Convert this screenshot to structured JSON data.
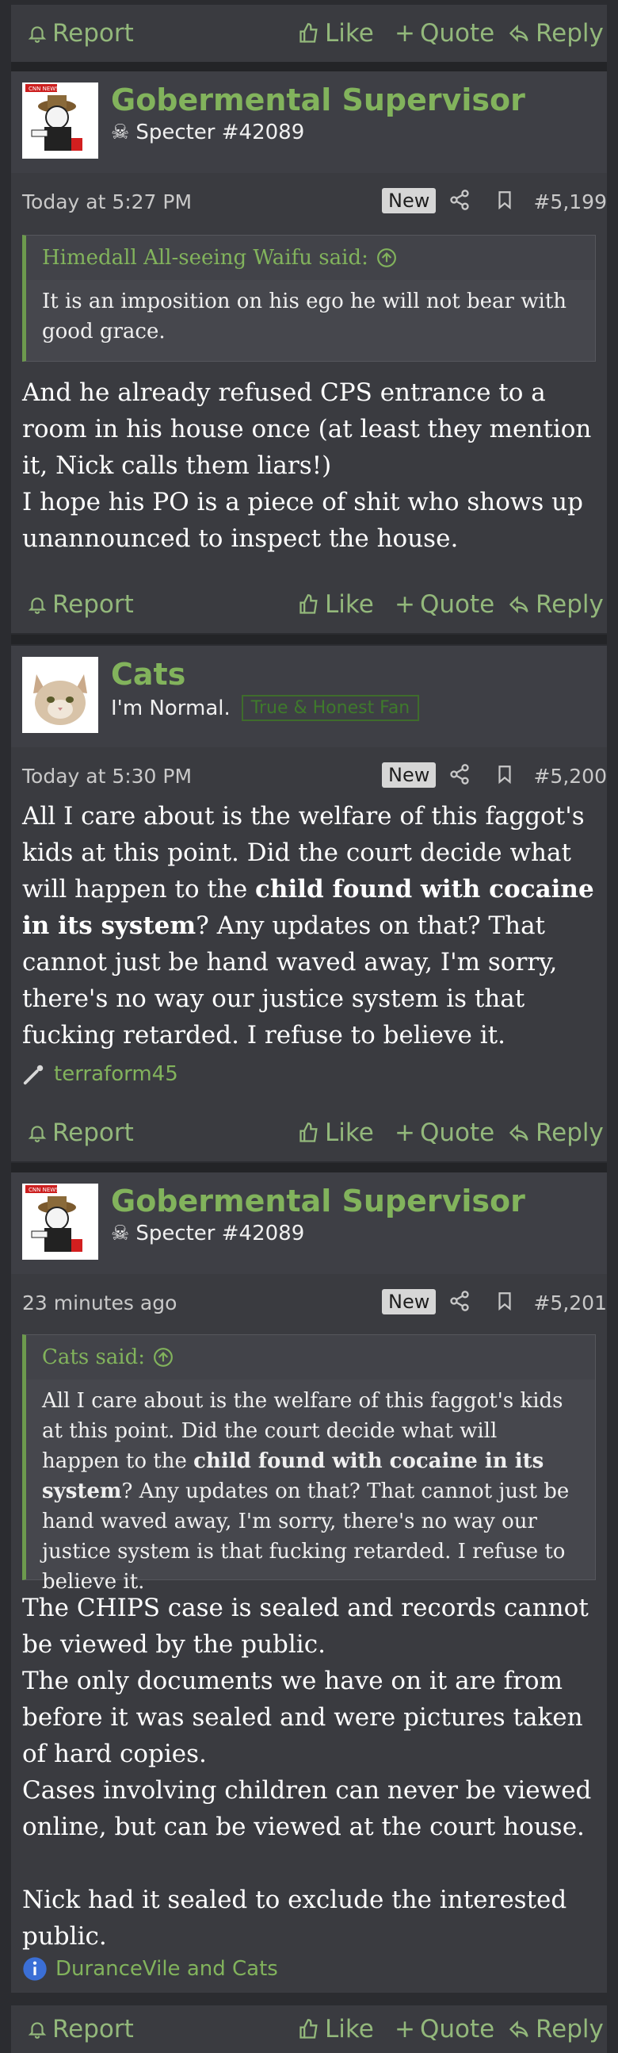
{
  "actions": {
    "report": "Report",
    "like": "Like",
    "quote": "Quote",
    "reply": "Reply"
  },
  "colors": {
    "accent": "#82b35c",
    "background": "#2b2c30",
    "post_bg": "#3a3b40"
  },
  "posts": [
    {
      "username": "Gobermental Supervisor",
      "usertitle": "Specter #42089",
      "avatar": "cnn-cartoon-avatar",
      "time": "Today at 5:27 PM",
      "new_label": "New",
      "number": "#5,199",
      "quote": {
        "author": "Himedall All-seeing Waifu said:",
        "text": "It is an imposition on his ego he will not bear with good grace."
      },
      "body": [
        "And he already refused CPS entrance to a room in his house once (at least they mention it, Nick calls them liars!)",
        "I hope his PO is a piece of shit who shows up unannounced to inspect the house."
      ]
    },
    {
      "username": "Cats",
      "usertitle": "I'm Normal.",
      "banner": "True & Honest Fan",
      "avatar": "cat-avatar",
      "time": "Today at 5:30 PM",
      "new_label": "New",
      "number": "#5,200",
      "body_pre": "All I care about is the welfare of this faggot's kids at this point. Did the court decide what will happen to the ",
      "body_bold": "child found with cocaine in its system",
      "body_post": "? Any updates on that? That cannot just be hand waved away, I'm sorry, there's no way our justice system is that fucking retarded. I refuse to believe it.",
      "reactions": "terraform45"
    },
    {
      "username": "Gobermental Supervisor",
      "usertitle": "Specter #42089",
      "avatar": "cnn-cartoon-avatar",
      "time": "23 minutes ago",
      "new_label": "New",
      "number": "#5,201",
      "quote": {
        "author": "Cats said:",
        "text_pre": "All I care about is the welfare of this faggot's kids at this point. Did the court decide what will happen to the ",
        "text_bold": "child found with cocaine in its system",
        "text_post": "? Any updates on that? That cannot just be hand waved away, I'm sorry, there's no way our justice system is that fucking retarded. I refuse to believe it."
      },
      "body": [
        "The CHIPS case is sealed and records cannot be viewed by the public.",
        "The only documents we have on it are from before it was sealed and were pictures taken of hard copies.",
        "Cases involving children can never be viewed online, but can be viewed at the court house.",
        "Nick had it sealed to exclude the interested public."
      ],
      "reactions": "DuranceVile and Cats"
    }
  ]
}
